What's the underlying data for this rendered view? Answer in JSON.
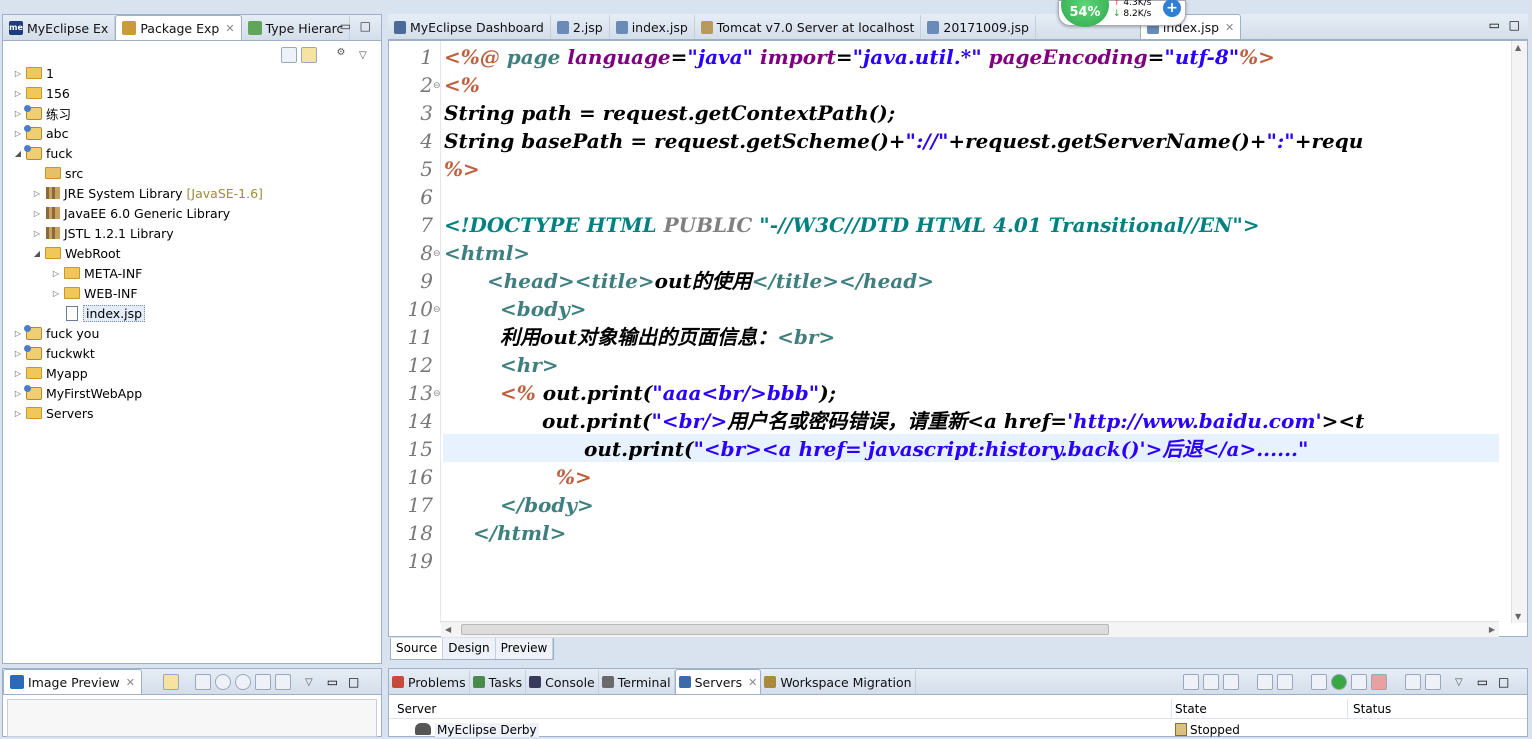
{
  "left_tabs": [
    "MyEclipse Ex",
    "Package Exp",
    "Type Hierarc"
  ],
  "tree": [
    {
      "label": "1",
      "icon": "folder-icon",
      "depth": 0,
      "toggle": "collapsed"
    },
    {
      "label": "156",
      "icon": "folder-icon",
      "depth": 0,
      "toggle": "collapsed"
    },
    {
      "label": "练习",
      "icon": "project-icon",
      "depth": 0,
      "toggle": "collapsed"
    },
    {
      "label": "abc",
      "icon": "project-icon",
      "depth": 0,
      "toggle": "collapsed"
    },
    {
      "label": "fuck",
      "icon": "project-icon",
      "depth": 0,
      "toggle": "expanded"
    },
    {
      "label": "src",
      "icon": "package-icon",
      "depth": 1,
      "toggle": "none"
    },
    {
      "label": "JRE System Library",
      "suffix": "[JavaSE-1.6]",
      "icon": "library-icon",
      "depth": 1,
      "toggle": "collapsed"
    },
    {
      "label": "JavaEE 6.0 Generic Library",
      "icon": "library-icon",
      "depth": 1,
      "toggle": "collapsed"
    },
    {
      "label": "JSTL 1.2.1 Library",
      "icon": "library-icon",
      "depth": 1,
      "toggle": "collapsed"
    },
    {
      "label": "WebRoot",
      "icon": "folder-icon",
      "depth": 1,
      "toggle": "expanded"
    },
    {
      "label": "META-INF",
      "icon": "folder-icon",
      "depth": 2,
      "toggle": "collapsed"
    },
    {
      "label": "WEB-INF",
      "icon": "folder-icon",
      "depth": 2,
      "toggle": "collapsed"
    },
    {
      "label": "index.jsp",
      "icon": "jsp-file-icon",
      "depth": 2,
      "toggle": "none",
      "selected": true
    },
    {
      "label": "fuck you",
      "icon": "project-icon",
      "depth": 0,
      "toggle": "collapsed"
    },
    {
      "label": "fuckwkt",
      "icon": "project-icon",
      "depth": 0,
      "toggle": "collapsed"
    },
    {
      "label": "Myapp",
      "icon": "folder-icon",
      "depth": 0,
      "toggle": "collapsed"
    },
    {
      "label": "MyFirstWebApp",
      "icon": "project-icon",
      "depth": 0,
      "toggle": "collapsed"
    },
    {
      "label": "Servers",
      "icon": "folder-icon",
      "depth": 0,
      "toggle": "collapsed"
    }
  ],
  "editor_tabs": [
    {
      "label": "MyEclipse Dashboard",
      "icon": "dashboard-icon"
    },
    {
      "label": "2.jsp",
      "icon": "jsp-file-icon"
    },
    {
      "label": "index.jsp",
      "icon": "jsp-file-icon"
    },
    {
      "label": "Tomcat v7.0 Server at localhost",
      "icon": "server-icon"
    },
    {
      "label": "20171009.jsp",
      "icon": "jsp-file-icon"
    },
    {
      "label": "index.jsp",
      "icon": "jsp-file-icon",
      "active": true
    }
  ],
  "net_widget": {
    "percent": "54%",
    "upload": "4.3K/s",
    "download": "8.2K/s"
  },
  "line_numbers": [
    "1",
    "2",
    "3",
    "4",
    "5",
    "6",
    "7",
    "8",
    "9",
    "10",
    "11",
    "12",
    "13",
    "14",
    "15",
    "16",
    "17",
    "18",
    "19"
  ],
  "code": {
    "l1": [
      "<%@ ",
      "page ",
      "language",
      "=",
      "\"java\"",
      " ",
      "import",
      "=",
      "\"java.util.*\"",
      " ",
      "pageEncoding",
      "=",
      "\"utf-8\"",
      "%>"
    ],
    "l2": "<%",
    "l3": "String path = request.getContextPath();",
    "l4": [
      "String basePath = request.getScheme()+",
      "\"://\"",
      "+request.getServerName()+",
      "\":\"",
      "+requ"
    ],
    "l5": "%>",
    "l7": [
      "<!DOCTYPE ",
      "HTML ",
      "PUBLIC ",
      "\"-//W3C//DTD HTML 4.01 Transitional//EN\"",
      ">"
    ],
    "l8": "<html>",
    "l9": [
      "<head><title>",
      "out的使用",
      "</title></head>"
    ],
    "l10": "<body>",
    "l11": [
      "利用out对象输出的页面信息：",
      "<br>"
    ],
    "l12": "<hr>",
    "l13": [
      "<% ",
      "out.print(",
      "\"aaa<br/>bbb\"",
      ");"
    ],
    "l14": [
      "out.print(",
      "\"<br/>",
      "用户名或密码错误，请重新",
      "<a href=",
      "'http://www.baidu.com'",
      "><t"
    ],
    "l15": [
      "out.print(",
      "\"<br><a href=",
      "'javascript:history.back()'",
      ">",
      "后退",
      "</a>......\""
    ],
    "l16": "%>",
    "l17": "</body>",
    "l18": "</html>"
  },
  "editor_mode_tabs": [
    "Source",
    "Design",
    "Preview"
  ],
  "image_preview_tab": "Image Preview",
  "bottom_tabs": [
    {
      "label": "Problems",
      "icon": "problems-icon"
    },
    {
      "label": "Tasks",
      "icon": "tasks-icon"
    },
    {
      "label": "Console",
      "icon": "console-icon"
    },
    {
      "label": "Terminal",
      "icon": "terminal-icon"
    },
    {
      "label": "Servers",
      "icon": "servers-icon",
      "active": true
    },
    {
      "label": "Workspace Migration",
      "icon": "migration-icon"
    }
  ],
  "servers_table": {
    "columns": [
      "Server",
      "State",
      "Status"
    ],
    "rows": [
      {
        "server": "MyEclipse Derby",
        "state": "Stopped",
        "status": ""
      }
    ]
  },
  "colors": {
    "tag": "#3f7f7f",
    "attr": "#7f007f",
    "value": "#2a00ff",
    "delim": "#bf5f3f",
    "highlight": "#e8f2fe"
  }
}
